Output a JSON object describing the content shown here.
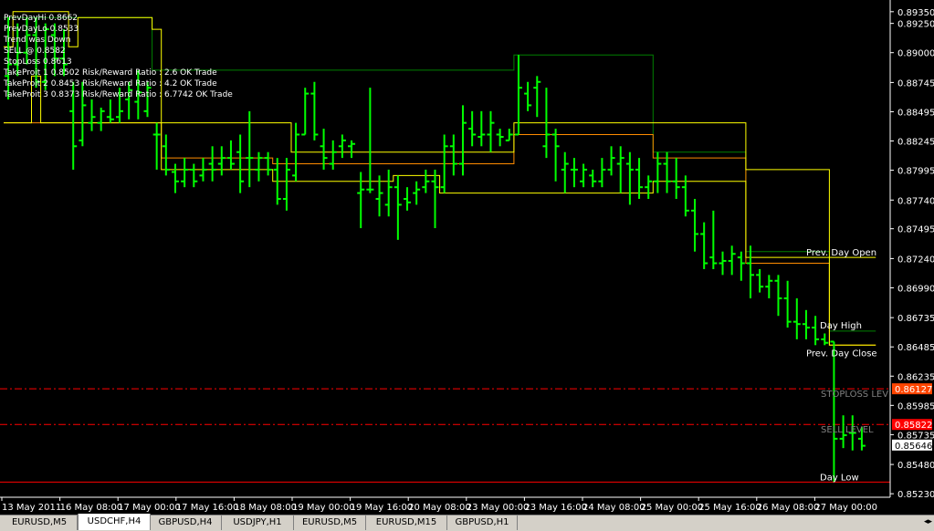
{
  "tabs": [
    "EURUSD,M5",
    "USDCHF,H4",
    "GBPUSD,H4",
    "USDJPY,H1",
    "EURUSD,M5",
    "EURUSD,M15",
    "GBPUSD,H1"
  ],
  "active_tab": 1,
  "tab_scroll_label": "◂▸",
  "info_lines": [
    "PrevDayHi 0.8662",
    "PrevDayLo 0.8533",
    "Trend was Down",
    "SELL @ 0.8582",
    "StopLoss 0.8613",
    "TakeProit 1 0.8502 Risk/Reward Ratio : 2.6 OK Trade",
    "TakeProit 2 0.8453 Risk/Reward Ratio : 4.2 OK Trade",
    "TakeProit 3 0.8373 Risk/Reward Ratio : 6.7742 OK Trade"
  ],
  "colors": {
    "background": "#000000",
    "bars": "#00ff00",
    "yellow_line": "#ffff00",
    "green_line": "#008000",
    "orange_line": "#ff8c00",
    "red_level": "#ff0000",
    "text": "#ffffff",
    "axis": "#ffffff",
    "stoploss_label": "#808080",
    "stoploss_badge": "#ff4500",
    "sell_badge": "#ff0000",
    "current_badge": "#ffffff"
  },
  "chart_data": {
    "type": "ohlc",
    "symbol": "USDCHF,H4",
    "ylim": [
      0.852,
      0.8945
    ],
    "y_ticks": [
      "0.89350",
      "0.89250",
      "0.89000",
      "0.88745",
      "0.88495",
      "0.88245",
      "0.87995",
      "0.87740",
      "0.87495",
      "0.87240",
      "0.86990",
      "0.86735",
      "0.86485",
      "0.86235",
      "0.85985",
      "0.85735",
      "0.85480",
      "0.85230"
    ],
    "x_labels": [
      "13 May 2011",
      "16 May 08:00",
      "17 May 00:00",
      "17 May 16:00",
      "18 May 08:00",
      "19 May 00:00",
      "19 May 16:00",
      "20 May 08:00",
      "23 May 00:00",
      "23 May 16:00",
      "24 May 08:00",
      "25 May 00:00",
      "25 May 16:00",
      "26 May 08:00",
      "27 May 00:00"
    ],
    "bars": [
      [
        0.888,
        0.893,
        0.886,
        0.889
      ],
      [
        0.889,
        0.8925,
        0.888,
        0.89
      ],
      [
        0.89,
        0.893,
        0.889,
        0.8915
      ],
      [
        0.8915,
        0.893,
        0.887,
        0.8875
      ],
      [
        0.8875,
        0.8925,
        0.8868,
        0.892
      ],
      [
        0.8915,
        0.8925,
        0.888,
        0.8895
      ],
      [
        0.8895,
        0.892,
        0.888,
        0.889
      ],
      [
        0.885,
        0.8875,
        0.88,
        0.882
      ],
      [
        0.8825,
        0.8875,
        0.882,
        0.8855
      ],
      [
        0.884,
        0.886,
        0.8833,
        0.8845
      ],
      [
        0.884,
        0.8853,
        0.8833,
        0.885
      ],
      [
        0.8845,
        0.886,
        0.884,
        0.8843
      ],
      [
        0.8845,
        0.887,
        0.884,
        0.885
      ],
      [
        0.886,
        0.8875,
        0.8843,
        0.8868
      ],
      [
        0.8858,
        0.8885,
        0.8843,
        0.8866
      ],
      [
        0.885,
        0.8875,
        0.8845,
        0.887
      ],
      [
        0.883,
        0.884,
        0.88,
        0.883
      ],
      [
        0.882,
        0.883,
        0.8795,
        0.88
      ],
      [
        0.8798,
        0.8805,
        0.878,
        0.879
      ],
      [
        0.879,
        0.881,
        0.8785,
        0.88
      ],
      [
        0.88,
        0.8805,
        0.8785,
        0.879
      ],
      [
        0.8795,
        0.881,
        0.879,
        0.88
      ],
      [
        0.8805,
        0.882,
        0.879,
        0.88
      ],
      [
        0.8805,
        0.882,
        0.8795,
        0.881
      ],
      [
        0.881,
        0.8825,
        0.88,
        0.8805
      ],
      [
        0.8815,
        0.883,
        0.878,
        0.879
      ],
      [
        0.881,
        0.885,
        0.8785,
        0.881
      ],
      [
        0.88,
        0.8815,
        0.879,
        0.881
      ],
      [
        0.881,
        0.8815,
        0.8795,
        0.88
      ],
      [
        0.88,
        0.881,
        0.877,
        0.8775
      ],
      [
        0.8775,
        0.881,
        0.8765,
        0.88
      ],
      [
        0.8795,
        0.884,
        0.879,
        0.883
      ],
      [
        0.883,
        0.887,
        0.883,
        0.8865
      ],
      [
        0.8865,
        0.8875,
        0.8825,
        0.883
      ],
      [
        0.882,
        0.8835,
        0.88,
        0.881
      ],
      [
        0.8805,
        0.8825,
        0.88,
        0.8815
      ],
      [
        0.882,
        0.883,
        0.881,
        0.8825
      ],
      [
        0.882,
        0.8825,
        0.881,
        0.8822
      ],
      [
        0.878,
        0.8798,
        0.875,
        0.8783
      ],
      [
        0.8783,
        0.887,
        0.878,
        0.8783
      ],
      [
        0.8775,
        0.8795,
        0.876,
        0.878
      ],
      [
        0.877,
        0.88,
        0.876,
        0.8785
      ],
      [
        0.8785,
        0.8795,
        0.874,
        0.877
      ],
      [
        0.8775,
        0.8785,
        0.8765,
        0.8772
      ],
      [
        0.878,
        0.879,
        0.877,
        0.8783
      ],
      [
        0.8785,
        0.88,
        0.878,
        0.879
      ],
      [
        0.879,
        0.88,
        0.875,
        0.8785
      ],
      [
        0.8785,
        0.883,
        0.878,
        0.882
      ],
      [
        0.882,
        0.883,
        0.8795,
        0.8805
      ],
      [
        0.8805,
        0.8855,
        0.8795,
        0.884
      ],
      [
        0.8835,
        0.885,
        0.882,
        0.883
      ],
      [
        0.8828,
        0.885,
        0.882,
        0.883
      ],
      [
        0.883,
        0.885,
        0.8815,
        0.884
      ],
      [
        0.883,
        0.8835,
        0.882,
        0.8828
      ],
      [
        0.8825,
        0.8835,
        0.8825,
        0.883
      ],
      [
        0.883,
        0.8898,
        0.883,
        0.887
      ],
      [
        0.8865,
        0.8875,
        0.885,
        0.8855
      ],
      [
        0.887,
        0.888,
        0.8845,
        0.8875
      ],
      [
        0.882,
        0.887,
        0.881,
        0.883
      ],
      [
        0.883,
        0.8835,
        0.879,
        0.882
      ],
      [
        0.88,
        0.8815,
        0.878,
        0.8805
      ],
      [
        0.88,
        0.881,
        0.8785,
        0.88
      ],
      [
        0.879,
        0.8805,
        0.8785,
        0.88
      ],
      [
        0.8795,
        0.88,
        0.8785,
        0.879
      ],
      [
        0.879,
        0.881,
        0.8785,
        0.88
      ],
      [
        0.88,
        0.882,
        0.8795,
        0.881
      ],
      [
        0.8805,
        0.882,
        0.878,
        0.881
      ],
      [
        0.8805,
        0.8815,
        0.877,
        0.88
      ],
      [
        0.88,
        0.881,
        0.8775,
        0.8785
      ],
      [
        0.8785,
        0.8795,
        0.8775,
        0.879
      ],
      [
        0.879,
        0.8815,
        0.878,
        0.8805
      ],
      [
        0.8805,
        0.8815,
        0.878,
        0.879
      ],
      [
        0.879,
        0.881,
        0.8775,
        0.8785
      ],
      [
        0.8785,
        0.8795,
        0.876,
        0.8765
      ],
      [
        0.8765,
        0.8775,
        0.873,
        0.8745
      ],
      [
        0.8745,
        0.8755,
        0.8715,
        0.872
      ],
      [
        0.8725,
        0.8765,
        0.8715,
        0.872
      ],
      [
        0.872,
        0.873,
        0.871,
        0.8722
      ],
      [
        0.8722,
        0.8735,
        0.871,
        0.8728
      ],
      [
        0.8725,
        0.873,
        0.8705,
        0.872
      ],
      [
        0.872,
        0.8735,
        0.869,
        0.871
      ],
      [
        0.871,
        0.8715,
        0.8695,
        0.87
      ],
      [
        0.87,
        0.871,
        0.869,
        0.8705
      ],
      [
        0.8705,
        0.871,
        0.8675,
        0.869
      ],
      [
        0.869,
        0.8705,
        0.8665,
        0.867
      ],
      [
        0.867,
        0.869,
        0.8655,
        0.8668
      ],
      [
        0.8668,
        0.868,
        0.8655,
        0.8665
      ],
      [
        0.8665,
        0.8675,
        0.865,
        0.8655
      ],
      [
        0.8655,
        0.866,
        0.865,
        0.8652
      ],
      [
        0.8653,
        0.8653,
        0.8533,
        0.857
      ],
      [
        0.857,
        0.859,
        0.8562,
        0.8573
      ],
      [
        0.8575,
        0.859,
        0.856,
        0.8575
      ],
      [
        0.857,
        0.858,
        0.856,
        0.8564
      ]
    ],
    "lines": {
      "yellow_upper": [
        0.8905,
        0.8935,
        0.8935,
        0.8935,
        0.8935,
        0.8935,
        0.8935,
        0.8905,
        0.893,
        0.893,
        0.893,
        0.893,
        0.893,
        0.893,
        0.893,
        0.893,
        0.892,
        0.884,
        0.884,
        0.884,
        0.884,
        0.884,
        0.884,
        0.884,
        0.884,
        0.884,
        0.884,
        0.884,
        0.884,
        0.884,
        0.884,
        0.8815,
        0.8815,
        0.8815,
        0.8815,
        0.8815,
        0.8815,
        0.8815,
        0.8815,
        0.8815,
        0.8815,
        0.8815,
        0.8815,
        0.8815,
        0.8815,
        0.8815,
        0.8815,
        0.8815,
        0.8815,
        0.8815,
        0.8815,
        0.8815,
        0.8815,
        0.8815,
        0.8815,
        0.884,
        0.884,
        0.884,
        0.884,
        0.884,
        0.884,
        0.884,
        0.884,
        0.884,
        0.884,
        0.884,
        0.884,
        0.884,
        0.884,
        0.884,
        0.884,
        0.884,
        0.884,
        0.884,
        0.884,
        0.884,
        0.884,
        0.884,
        0.884,
        0.884,
        0.88,
        0.88,
        0.88,
        0.88,
        0.88,
        0.88,
        0.88,
        0.88,
        0.88,
        0.8725,
        0.8725,
        0.8725,
        0.8725,
        0.8725
      ],
      "yellow_lower": [
        0.884,
        0.884,
        0.884,
        0.888,
        0.884,
        0.884,
        0.884,
        0.884,
        0.884,
        0.884,
        0.884,
        0.884,
        0.884,
        0.884,
        0.884,
        0.884,
        0.884,
        0.88,
        0.88,
        0.88,
        0.88,
        0.88,
        0.88,
        0.88,
        0.88,
        0.88,
        0.88,
        0.88,
        0.88,
        0.879,
        0.879,
        0.879,
        0.879,
        0.879,
        0.879,
        0.879,
        0.879,
        0.879,
        0.879,
        0.879,
        0.879,
        0.879,
        0.8795,
        0.8795,
        0.8795,
        0.8795,
        0.8795,
        0.878,
        0.878,
        0.878,
        0.878,
        0.878,
        0.878,
        0.878,
        0.878,
        0.878,
        0.878,
        0.878,
        0.878,
        0.878,
        0.878,
        0.878,
        0.878,
        0.878,
        0.878,
        0.878,
        0.878,
        0.878,
        0.878,
        0.878,
        0.879,
        0.879,
        0.879,
        0.879,
        0.879,
        0.879,
        0.879,
        0.879,
        0.879,
        0.879,
        0.8725,
        0.8725,
        0.8725,
        0.8725,
        0.8725,
        0.8725,
        0.8725,
        0.8725,
        0.8725,
        0.865,
        0.865,
        0.865,
        0.865,
        0.865
      ],
      "green_upper": [
        0.893,
        0.893,
        0.893,
        0.893,
        0.893,
        0.893,
        0.893,
        0.893,
        0.893,
        0.893,
        0.893,
        0.893,
        0.893,
        0.893,
        0.893,
        0.893,
        0.8885,
        0.8885,
        0.8885,
        0.8885,
        0.8885,
        0.8885,
        0.8885,
        0.8885,
        0.8885,
        0.8885,
        0.8885,
        0.8885,
        0.8885,
        0.8885,
        0.8885,
        0.8885,
        0.8885,
        0.8885,
        0.8885,
        0.8885,
        0.8885,
        0.8885,
        0.8885,
        0.8885,
        0.8885,
        0.8885,
        0.8885,
        0.8885,
        0.8885,
        0.8885,
        0.8885,
        0.8885,
        0.8885,
        0.8885,
        0.8885,
        0.8885,
        0.8885,
        0.8885,
        0.8885,
        0.8898,
        0.8898,
        0.8898,
        0.8898,
        0.8898,
        0.8898,
        0.8898,
        0.8898,
        0.8898,
        0.8898,
        0.8898,
        0.8898,
        0.8898,
        0.8898,
        0.8898,
        0.8815,
        0.8815,
        0.8815,
        0.8815,
        0.8815,
        0.8815,
        0.8815,
        0.8815,
        0.8815,
        0.8815,
        0.873,
        0.873,
        0.873,
        0.873,
        0.873,
        0.873,
        0.873,
        0.873,
        0.873,
        0.8662,
        0.8662,
        0.8662,
        0.8662,
        0.8662
      ],
      "orange_mid": [
        0.884,
        0.884,
        0.884,
        0.884,
        0.884,
        0.884,
        0.884,
        0.884,
        0.884,
        0.884,
        0.884,
        0.884,
        0.884,
        0.884,
        0.884,
        0.884,
        0.884,
        0.881,
        0.881,
        0.881,
        0.881,
        0.881,
        0.881,
        0.881,
        0.881,
        0.881,
        0.881,
        0.881,
        0.881,
        0.8805,
        0.8805,
        0.8805,
        0.8805,
        0.8805,
        0.8805,
        0.8805,
        0.8805,
        0.8805,
        0.8805,
        0.8805,
        0.8805,
        0.8805,
        0.8805,
        0.8805,
        0.8805,
        0.8805,
        0.8805,
        0.8805,
        0.8805,
        0.8805,
        0.8805,
        0.8805,
        0.8805,
        0.8805,
        0.8805,
        0.883,
        0.883,
        0.883,
        0.883,
        0.883,
        0.883,
        0.883,
        0.883,
        0.883,
        0.883,
        0.883,
        0.883,
        0.883,
        0.883,
        0.883,
        0.881,
        0.881,
        0.881,
        0.881,
        0.881,
        0.881,
        0.881,
        0.881,
        0.881,
        0.881,
        0.872,
        0.872,
        0.872,
        0.872,
        0.872,
        0.872,
        0.872,
        0.872,
        0.872,
        0.865,
        0.865,
        0.865,
        0.865,
        0.865
      ]
    },
    "levels": [
      {
        "name": "STOPLOSS LEVEL",
        "label": "STOPLOSS LEV",
        "value": 0.86127,
        "badge": "0.86127",
        "style": "dash-dot",
        "color": "#ff0000"
      },
      {
        "name": "SELL LEVEL",
        "label": "SELL LEVEL",
        "value": 0.85822,
        "badge": "0.85822",
        "style": "dash-dot",
        "color": "#ff0000"
      },
      {
        "name": "Day Low",
        "label": "Day Low",
        "value": 0.8533,
        "style": "solid",
        "color": "#ff0000"
      }
    ],
    "current_price": "0.85646",
    "labels": [
      {
        "text": "Prev. Day Open",
        "value": 0.8725
      },
      {
        "text": "Day High",
        "value": 0.8662
      },
      {
        "text": "Prev. Day Close",
        "value": 0.865
      },
      {
        "text": "Day Low",
        "value": 0.8533
      }
    ]
  }
}
